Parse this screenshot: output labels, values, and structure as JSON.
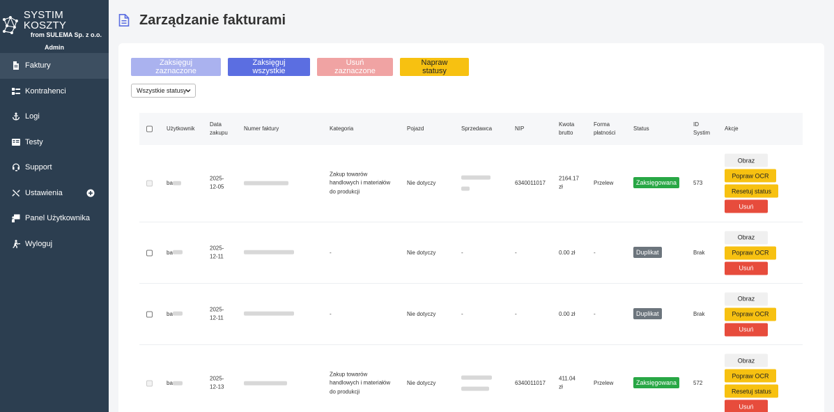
{
  "brand": {
    "title": "SYSTIM KOSZTY",
    "subtitle": "from SULEMA Sp. z o.o.",
    "user": "Admin"
  },
  "nav": [
    {
      "label": "Faktury",
      "icon": "document-icon",
      "active": true
    },
    {
      "label": "Kontrahenci",
      "icon": "sitemap-icon"
    },
    {
      "label": "Logi",
      "icon": "anchor-icon"
    },
    {
      "label": "Testy",
      "icon": "testy-icon"
    },
    {
      "label": "Support",
      "icon": "headset-icon"
    },
    {
      "label": "Ustawienia",
      "icon": "tools-icon",
      "expand_icon": "plus-circle-icon"
    },
    {
      "label": "Panel Użytkownika",
      "icon": "user-panel-icon"
    },
    {
      "label": "Wyloguj",
      "icon": "logout-icon"
    }
  ],
  "page": {
    "title": "Zarządzanie fakturami"
  },
  "toolbar": {
    "book_selected": "Zaksięguj zaznaczone",
    "book_all": "Zaksięguj wszystkie",
    "delete_selected": "Usuń zaznaczone",
    "fix_statuses": "Napraw statusy"
  },
  "filter": {
    "selected": "Wszystkie statusy"
  },
  "table": {
    "headers": {
      "user": "Użytkownik",
      "date_1": "Data",
      "date_2": "zakupu",
      "invoice_no": "Numer faktury",
      "category": "Kategoria",
      "vehicle": "Pojazd",
      "seller": "Sprzedawca",
      "nip": "NIP",
      "amount_1": "Kwota",
      "amount_2": "brutto",
      "payment_1": "Forma",
      "payment_2": "płatności",
      "status": "Status",
      "id_1": "ID",
      "id_2": "Systim",
      "actions": "Akcje"
    },
    "rows": [
      {
        "user": "ba",
        "date_1": "2025-",
        "date_2": "12-05",
        "category_1": "Zakup towarów",
        "category_2": "handlowych i materiałów",
        "category_3": "do produkcji",
        "vehicle": "Nie dotyczy",
        "nip": "6340011017",
        "amount_1": "2164.17",
        "amount_2": "zł",
        "payment": "Przelew",
        "status": "Zaksięgowana",
        "id": "573"
      },
      {
        "user": "ba",
        "date_1": "2025-",
        "date_2": "12-11",
        "category": "-",
        "vehicle": "Nie dotyczy",
        "seller": "-",
        "nip": "-",
        "amount": "0.00 zł",
        "payment": "-",
        "status": "Duplikat",
        "id": "Brak"
      },
      {
        "user": "ba",
        "date_1": "2025-",
        "date_2": "12-11",
        "category": "-",
        "vehicle": "Nie dotyczy",
        "seller": "-",
        "nip": "-",
        "amount": "0.00 zł",
        "payment": "-",
        "status": "Duplikat",
        "id": "Brak"
      },
      {
        "user": "ba",
        "date_1": "2025-",
        "date_2": "12-13",
        "category_1": "Zakup towarów",
        "category_2": "handlowych i materiałów",
        "category_3": "do produkcji",
        "vehicle": "Nie dotyczy",
        "nip": "6340011017",
        "amount_1": "411.04",
        "amount_2": "zł",
        "payment": "Przelew",
        "status": "Zaksięgowana",
        "id": "572"
      }
    ],
    "actions": {
      "image": "Obraz",
      "fix_ocr": "Popraw OCR",
      "reset_status": "Resetuj status",
      "delete": "Usuń"
    }
  },
  "colors": {
    "sidebar": "#2c3e50",
    "primary": "#5b6ee1",
    "warning": "#f7c111",
    "danger": "#e74c3c",
    "success": "#28a745",
    "secondary": "#6c757d"
  }
}
